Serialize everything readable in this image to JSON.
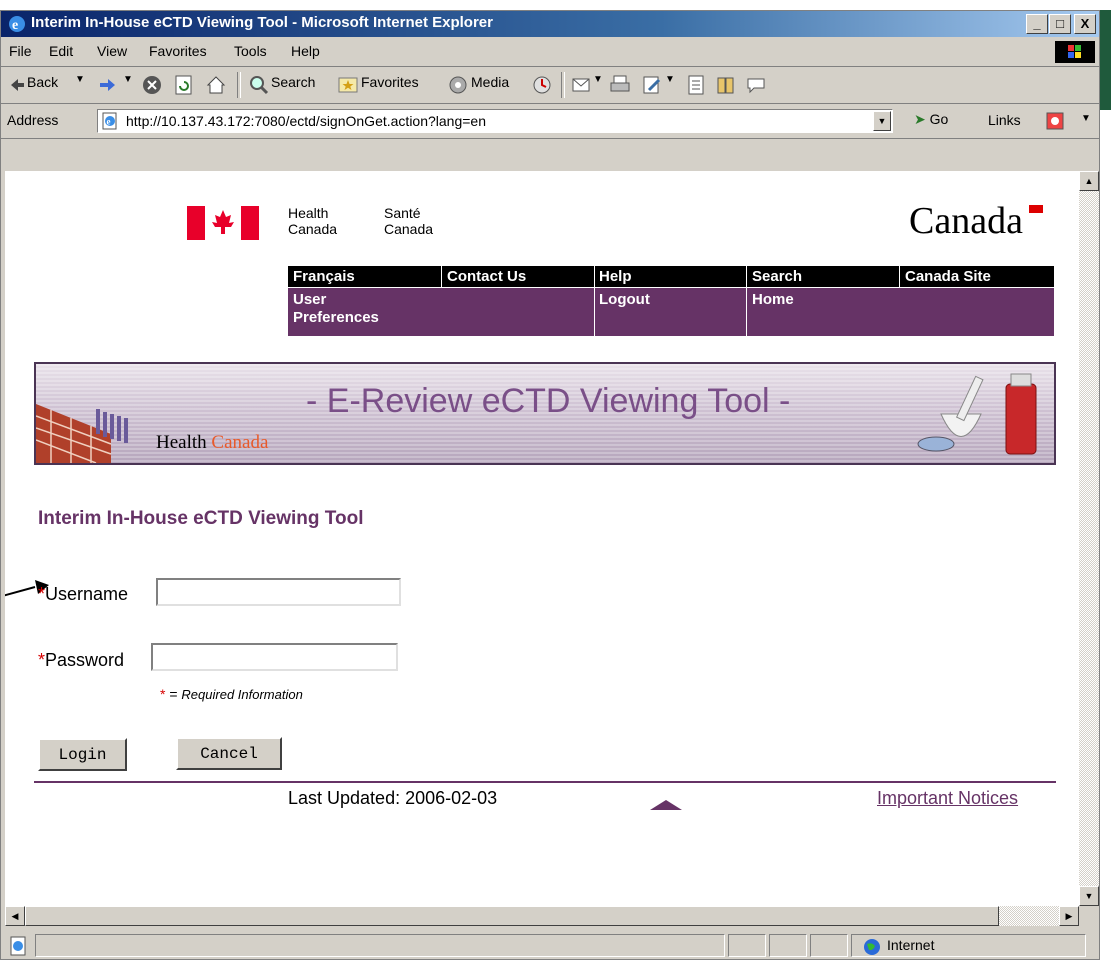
{
  "window": {
    "title": "Interim In-House eCTD Viewing Tool - Microsoft Internet Explorer",
    "controls": {
      "minimize": "_",
      "maximize": "□",
      "close": "X"
    }
  },
  "menu": [
    "File",
    "Edit",
    "View",
    "Favorites",
    "Tools",
    "Help"
  ],
  "toolbar": {
    "back": "Back",
    "search": "Search",
    "favorites": "Favorites",
    "media": "Media"
  },
  "address": {
    "label": "Address",
    "url": "http://10.137.43.172:7080/ectd/signOnGet.action?lang=en",
    "go": "Go",
    "links": "Links"
  },
  "header": {
    "health_en": [
      "Health",
      "Canada"
    ],
    "health_fr": [
      "Santé",
      "Canada"
    ],
    "wordmark": "Canada"
  },
  "nav": {
    "francais": "Français",
    "contact": "Contact Us",
    "help": "Help",
    "search": "Search",
    "canada_site": "Canada Site",
    "user_preferences_1": "User",
    "user_preferences_2": "Preferences",
    "logout": "Logout",
    "home": "Home"
  },
  "banner": {
    "title": "- E-Review eCTD Viewing Tool -",
    "brand_health": "Health",
    "brand_canada": "Canada"
  },
  "page": {
    "heading": "Interim In-House eCTD Viewing Tool"
  },
  "form": {
    "required_marker": "*",
    "username_label": "Username",
    "username_value": "",
    "password_label": "Password",
    "password_value": "",
    "required_equals": "=",
    "required_note": "Required Information",
    "login": "Login",
    "cancel": "Cancel"
  },
  "footer": {
    "last_updated": "Last Updated: 2006-02-03",
    "notices": "Important Notices"
  },
  "status": {
    "zone": "Internet"
  },
  "colors": {
    "accent_purple": "#663366",
    "required_red": "#d60000",
    "title_bar_blue": "#0a246a"
  }
}
